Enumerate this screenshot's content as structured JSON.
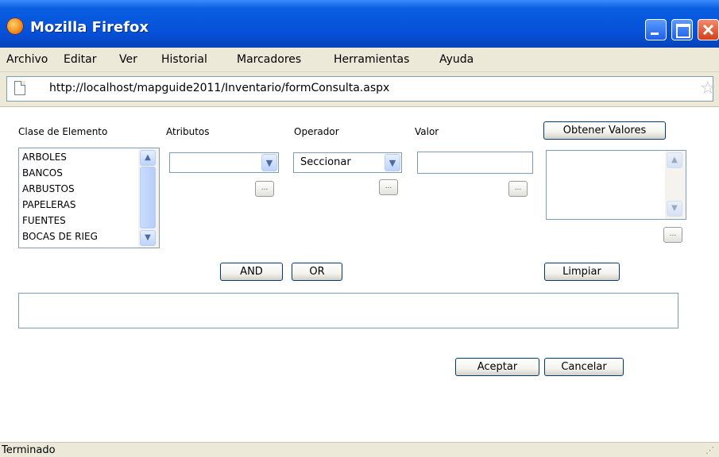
{
  "window": {
    "title": "Mozilla Firefox"
  },
  "menu": [
    "Archivo",
    "Editar",
    "Ver",
    "Historial",
    "Marcadores",
    "Herramientas",
    "Ayuda"
  ],
  "address": {
    "url": "http://localhost/mapguide2011/Inventario/formConsulta.aspx"
  },
  "form": {
    "labels": {
      "clase": "Clase de Elemento",
      "atributos": "Atributos",
      "operador": "Operador",
      "valor": "Valor"
    },
    "clase_options": [
      "ARBOLES",
      "BANCOS",
      "ARBUSTOS",
      "PAPELERAS",
      "FUENTES",
      "BOCAS DE RIEG"
    ],
    "atributos_selected": "",
    "operador_selected": "Seccionar",
    "valor_value": "",
    "buttons": {
      "obtener": "Obtener Valores",
      "and": "AND",
      "or": "OR",
      "limpiar": "Limpiar",
      "aceptar": "Aceptar",
      "cancelar": "Cancelar",
      "small": "..."
    }
  },
  "status": {
    "text": "Terminado"
  },
  "icons": {
    "app": "firefox-icon",
    "page": "page-icon",
    "bookmark": "star-icon",
    "dropdown": "chevron-down-icon",
    "scroll_up": "chevron-up-icon",
    "grip": "resize-grip-icon"
  },
  "colors": {
    "titlebar": "#0550d8",
    "chrome": "#ece9d8",
    "field_border": "#7f9db9",
    "button_border": "#003c74"
  }
}
